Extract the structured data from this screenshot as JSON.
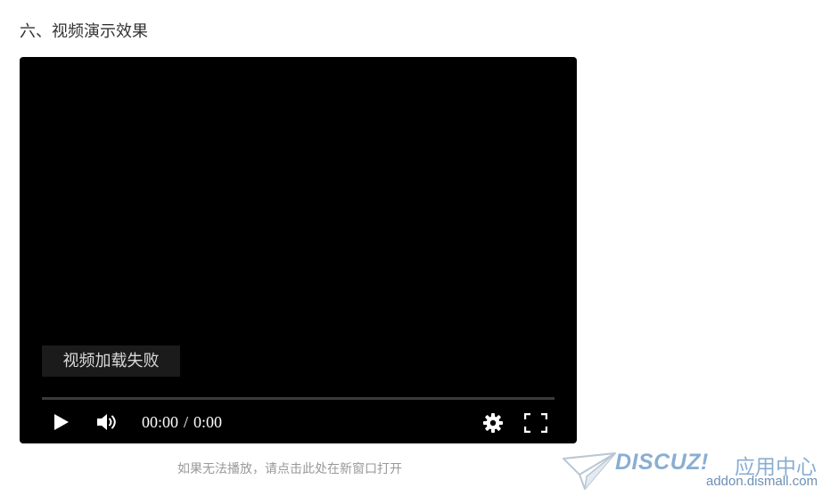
{
  "section": {
    "heading": "六、视频演示效果"
  },
  "player": {
    "error_message": "视频加载失败",
    "current_time": "00:00",
    "separator": "/",
    "duration": "0:00",
    "progress": 0,
    "icons": {
      "play": "play-icon",
      "volume": "volume-icon",
      "settings": "gear-icon",
      "fullscreen": "fullscreen-icon"
    },
    "colors": {
      "background": "#000000",
      "controls": "#ffffff",
      "track": "#3a3a3a"
    }
  },
  "fallback": {
    "link_text": "如果无法播放，请点击此处在新窗口打开"
  },
  "watermark": {
    "logo_text": "DISCUZ!",
    "title": "应用中心",
    "domain": "addon.dismall.com"
  }
}
